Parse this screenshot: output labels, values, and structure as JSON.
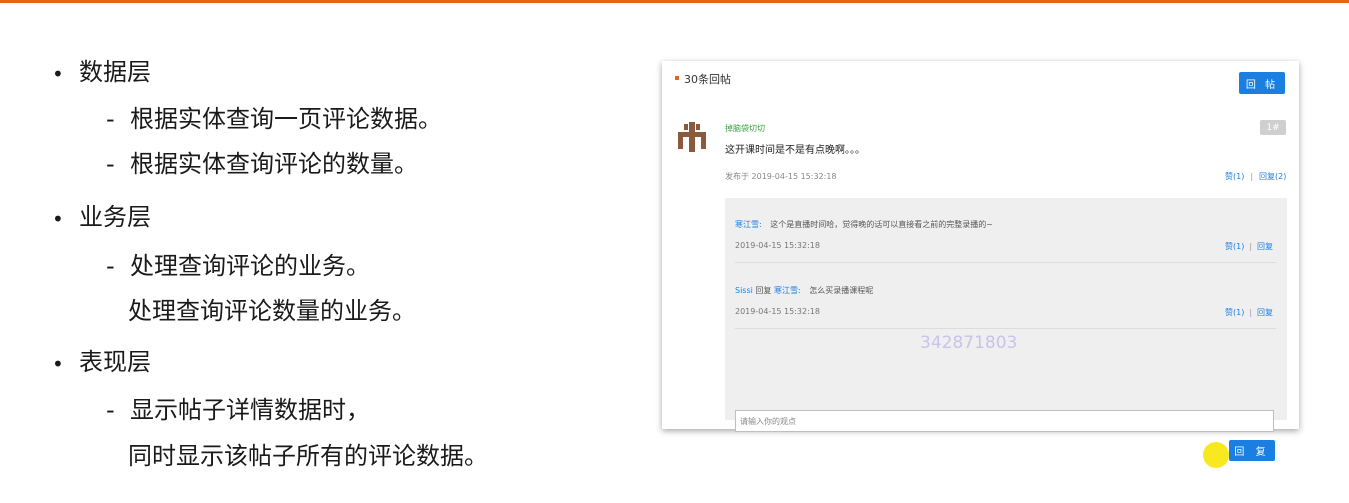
{
  "colors": {
    "accent": "#e8641b",
    "button_blue": "#1a7fe0",
    "username_green": "#3aa043",
    "cursor_yellow": "#f7e81f",
    "watermark": "#c8c3ea"
  },
  "outline": {
    "data_layer": {
      "title": "数据层",
      "items": [
        "根据实体查询一页评论数据。",
        "根据实体查询评论的数量。"
      ]
    },
    "service_layer": {
      "title": "业务层",
      "items": [
        "处理查询评论的业务。",
        "处理查询评论数量的业务。"
      ]
    },
    "presentation_layer": {
      "title": "表现层",
      "items": [
        "显示帖子详情数据时，",
        "同时显示该帖子所有的评论数据。"
      ]
    },
    "bullet_glyph": "•",
    "dash_glyph": "-"
  },
  "card": {
    "header_title": "30条回帖",
    "post_button": "回 帖",
    "comment": {
      "username": "掉脑袋切切",
      "floor": "1#",
      "text": "这开课时间是不是有点晚啊。。。",
      "time": "发布于 2019-04-15 15:32:18",
      "like": "赞(1)",
      "sep": "|",
      "reply": "回复(2)"
    },
    "replies": [
      {
        "name": "寒江雪:",
        "prefix": "",
        "target": "",
        "text": "这个是直播时间哈，觉得晚的话可以直接看之前的完整录播的~",
        "time": "2019-04-15 15:32:18",
        "like": "赞(1)",
        "reply": "回复"
      },
      {
        "name": "Sissi",
        "prefix": " 回复 ",
        "target": "寒江雪:",
        "text": "怎么买录播课程呢",
        "time": "2019-04-15 15:32:18",
        "like": "赞(1)",
        "reply": "回复"
      }
    ],
    "input_placeholder": "请输入你的观点",
    "reply_button": "回 复"
  },
  "watermark_text": "342871803"
}
